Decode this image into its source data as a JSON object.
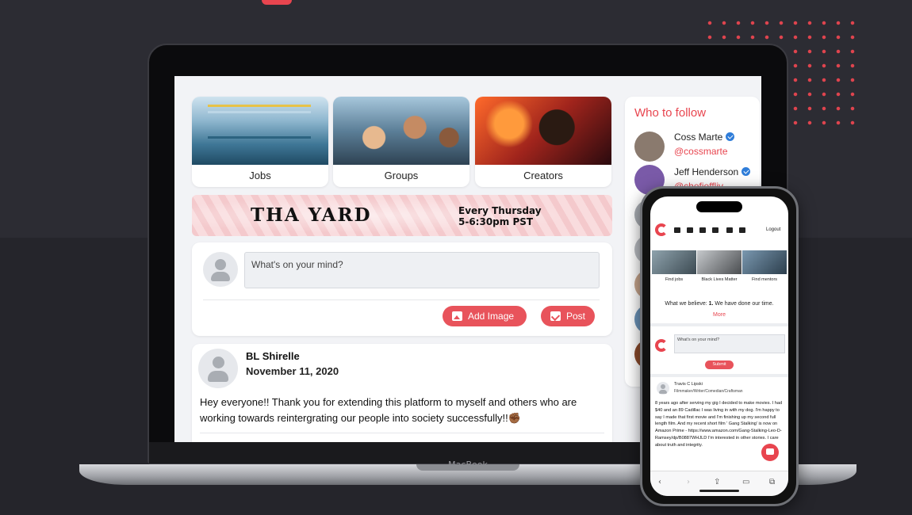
{
  "brand": {
    "accent": "#e8454f",
    "laptop_label": "MacBook"
  },
  "tiles": [
    {
      "label": "Jobs"
    },
    {
      "label": "Groups"
    },
    {
      "label": "Creators"
    }
  ],
  "banner": {
    "title": "THA YARD",
    "line1": "Every Thursday",
    "line2": "5-6:30pm PST"
  },
  "composer": {
    "placeholder": "What's on your mind?",
    "add_image": "Add Image",
    "post": "Post"
  },
  "post": {
    "author": "BL Shirelle",
    "date": "November 11, 2020",
    "body": "Hey everyone!! Thank you for extending this platform to myself and others who are working towards reintergrating our people into society successfully!!✊🏾"
  },
  "who_to_follow": {
    "title": "Who to follow",
    "users": [
      {
        "name": "Coss Marte",
        "handle": "@cossmarte",
        "verified": true
      },
      {
        "name": "Jeff Henderson",
        "handle": "@chefjeffliv",
        "verified": true
      }
    ]
  },
  "mobile": {
    "logout": "Logout",
    "tiles": [
      {
        "label": "Find jobs"
      },
      {
        "label": "Black Lives Matter"
      },
      {
        "label": "Find mentors"
      }
    ],
    "believe_prefix": "What we believe: ",
    "believe_bold": "1.",
    "believe_rest": " We have done our time.",
    "more": "More",
    "input_placeholder": "What's on your mind?",
    "submit": "Submit",
    "story_author": "Travis C Lipski",
    "story_role": "Filmmaker/Writer/Comedian/Craftsman",
    "story_body": "8 years ago after serving my gig I decided to make movies. I had $40 and an 89 Cadillac I was living in with my dog. I'm happy to say I made that first movie and I'm finishing up my second full length film. And my recent short film ' Gang Stalking' is now on Amazon Prime - https://www.amazon.com/Gang-Stalking-Leo-D-Ramsey/dp/B0887WHJLD I'm interested in other stories. I care about truth and integrity.",
    "toolbar": [
      "‹",
      "›",
      "⇪",
      "▭",
      "⧉"
    ]
  }
}
